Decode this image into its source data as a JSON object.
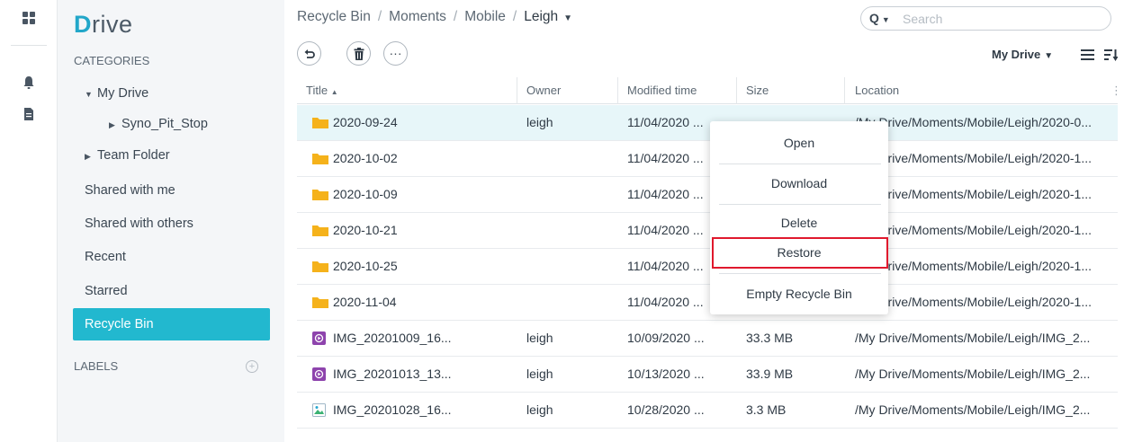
{
  "app": {
    "logo_first": "D",
    "logo_rest": "rive"
  },
  "rail": {
    "icons": [
      "apps-icon",
      "bell-icon",
      "document-icon"
    ]
  },
  "sidebar": {
    "categories_label": "CATEGORIES",
    "labels_label": "LABELS",
    "items": [
      {
        "label": "My Drive",
        "expanded": true
      },
      {
        "label": "Syno_Pit_Stop"
      },
      {
        "label": "Team Folder"
      },
      {
        "label": "Shared with me"
      },
      {
        "label": "Shared with others"
      },
      {
        "label": "Recent"
      },
      {
        "label": "Starred"
      },
      {
        "label": "Recycle Bin",
        "active": true
      }
    ]
  },
  "breadcrumb": [
    "Recycle Bin",
    "Moments",
    "Mobile",
    "Leigh"
  ],
  "search": {
    "label": "Q",
    "placeholder": "Search"
  },
  "toolbar": {
    "more_label": "···",
    "view_label": "My Drive"
  },
  "table": {
    "headers": [
      "Title",
      "Owner",
      "Modified time",
      "Size",
      "Location"
    ],
    "rows": [
      {
        "title": "2020-09-24",
        "type": "folder",
        "owner": "leigh",
        "modified": "11/04/2020 ...",
        "size": "",
        "location": "/My Drive/Moments/Mobile/Leigh/2020-0...",
        "selected": true
      },
      {
        "title": "2020-10-02",
        "type": "folder",
        "owner": "",
        "modified": "11/04/2020 ...",
        "size": "",
        "location": "/My Drive/Moments/Mobile/Leigh/2020-1..."
      },
      {
        "title": "2020-10-09",
        "type": "folder",
        "owner": "",
        "modified": "11/04/2020 ...",
        "size": "",
        "location": "/My Drive/Moments/Mobile/Leigh/2020-1..."
      },
      {
        "title": "2020-10-21",
        "type": "folder",
        "owner": "",
        "modified": "11/04/2020 ...",
        "size": "",
        "location": "/My Drive/Moments/Mobile/Leigh/2020-1..."
      },
      {
        "title": "2020-10-25",
        "type": "folder",
        "owner": "",
        "modified": "11/04/2020 ...",
        "size": "",
        "location": "/My Drive/Moments/Mobile/Leigh/2020-1..."
      },
      {
        "title": "2020-11-04",
        "type": "folder",
        "owner": "",
        "modified": "11/04/2020 ...",
        "size": "",
        "location": "/My Drive/Moments/Mobile/Leigh/2020-1..."
      },
      {
        "title": "IMG_20201009_16...",
        "type": "video",
        "owner": "leigh",
        "modified": "10/09/2020 ...",
        "size": "33.3 MB",
        "location": "/My Drive/Moments/Mobile/Leigh/IMG_2..."
      },
      {
        "title": "IMG_20201013_13...",
        "type": "video",
        "owner": "leigh",
        "modified": "10/13/2020 ...",
        "size": "33.9 MB",
        "location": "/My Drive/Moments/Mobile/Leigh/IMG_2..."
      },
      {
        "title": "IMG_20201028_16...",
        "type": "image",
        "owner": "leigh",
        "modified": "10/28/2020 ...",
        "size": "3.3 MB",
        "location": "/My Drive/Moments/Mobile/Leigh/IMG_2..."
      }
    ]
  },
  "context_menu": {
    "items": [
      "Open",
      "Download",
      "Delete",
      "Restore",
      "Empty Recycle Bin"
    ],
    "highlighted": "Restore"
  },
  "colors": {
    "accent": "#22b8cf",
    "folder": "#f5b21b",
    "video": "#8e44ad",
    "highlight": "#e0192d",
    "selected_row": "#e7f6f9"
  }
}
